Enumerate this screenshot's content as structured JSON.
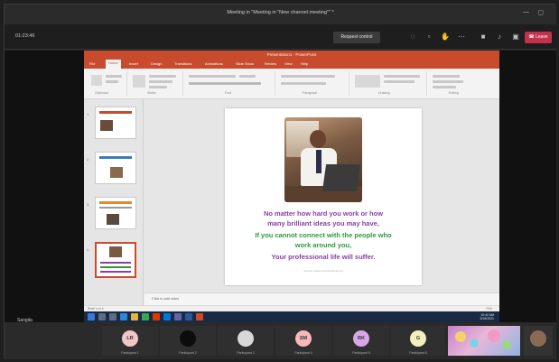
{
  "window": {
    "title": "Meeting in \"Meeting in \"New channel meeting\"\" *",
    "minimize_icon": "minimize-icon",
    "maximize_icon": "maximize-icon"
  },
  "meeting_bar": {
    "timer": "01:23:46",
    "request_control_label": "Request control",
    "icons": [
      "people-icon",
      "chat-icon",
      "raise-hand-icon",
      "more-icon",
      "camera-icon",
      "mic-icon",
      "share-icon"
    ],
    "leave_label": "Leave"
  },
  "powerpoint": {
    "title": "Presentation1 - PowerPoint",
    "tabs": [
      "File",
      "Home",
      "Insert",
      "Design",
      "Transitions",
      "Animations",
      "Slide Show",
      "Review",
      "View",
      "Help"
    ],
    "active_tab": "Home",
    "ribbon_groups": [
      "Clipboard",
      "Slides",
      "Font",
      "Paragraph",
      "Drawing",
      "Editing"
    ],
    "slides_count": 4,
    "selected_slide": 4,
    "status": "Slide 4 of 4",
    "zoom": "70%"
  },
  "slide": {
    "line1": "No matter how hard you work or how",
    "line2": "many brilliant ideas you may have,",
    "line3": "If you cannot connect with the people who",
    "line4": "work around you,",
    "line5": "Your professional life will suffer.",
    "credit": "Source: www.connectusfund.org"
  },
  "notes": "Click to add notes",
  "taskbar": {
    "time": "10:42 AM",
    "date": "3/15/2021"
  },
  "presenter": "Sangita",
  "participants": [
    {
      "initials": "LR",
      "color": "#f2c6c6",
      "name": "Participant 1"
    },
    {
      "initials": "",
      "color": "#111111",
      "name": "Participant 2"
    },
    {
      "initials": "",
      "color": "#d8d8d8",
      "name": "Participant 3"
    },
    {
      "initials": "SM",
      "color": "#f6b8b8",
      "name": "Participant 4"
    },
    {
      "initials": "RK",
      "color": "#d9a6e8",
      "name": "Participant 5"
    },
    {
      "initials": "G",
      "color": "#f3efc2",
      "name": "Participant 6"
    }
  ]
}
